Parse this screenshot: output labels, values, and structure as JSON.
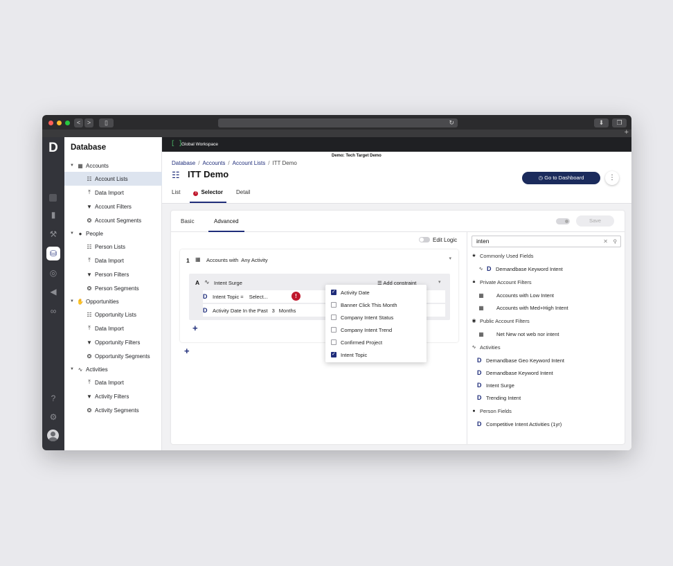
{
  "browser": {
    "back": "<",
    "forward": ">",
    "reload": "↻",
    "new_tab": "+"
  },
  "app": {
    "rail_icons": [
      "home-icon",
      "chart-icon",
      "magic-wand-icon",
      "database-icon",
      "target-icon",
      "megaphone-icon",
      "handshake-icon",
      "help-icon",
      "gear-icon",
      "avatar-icon"
    ],
    "brand_color": "#1f2d7a",
    "error_color": "#c0182d"
  },
  "nav": {
    "title": "Database",
    "tree": [
      {
        "label": "Accounts",
        "icon": "building-icon",
        "children": [
          {
            "label": "Account Lists",
            "icon": "list-icon",
            "selected": true
          },
          {
            "label": "Data Import",
            "icon": "upload-icon"
          },
          {
            "label": "Account Filters",
            "icon": "filter-icon"
          },
          {
            "label": "Account Segments",
            "icon": "segments-icon"
          }
        ]
      },
      {
        "label": "People",
        "icon": "person-icon",
        "children": [
          {
            "label": "Person Lists",
            "icon": "list-icon"
          },
          {
            "label": "Data Import",
            "icon": "upload-icon"
          },
          {
            "label": "Person Filters",
            "icon": "filter-icon"
          },
          {
            "label": "Person Segments",
            "icon": "segments-icon"
          }
        ]
      },
      {
        "label": "Opportunities",
        "icon": "handshake-icon",
        "children": [
          {
            "label": "Opportunity Lists",
            "icon": "list-icon"
          },
          {
            "label": "Data Import",
            "icon": "upload-icon"
          },
          {
            "label": "Opportunity Filters",
            "icon": "filter-icon"
          },
          {
            "label": "Opportunity Segments",
            "icon": "segments-icon"
          }
        ]
      },
      {
        "label": "Activities",
        "icon": "pulse-icon",
        "children": [
          {
            "label": "Data Import",
            "icon": "upload-icon"
          },
          {
            "label": "Activity Filters",
            "icon": "filter-icon"
          },
          {
            "label": "Activity Segments",
            "icon": "segments-icon"
          }
        ]
      }
    ]
  },
  "workspace": {
    "bracket": "[ ]",
    "title": "Global Workspace",
    "demo": "Demo: Tech Target Demo"
  },
  "header": {
    "breadcrumbs": [
      "Database",
      "Accounts",
      "Account Lists",
      "ITT Demo"
    ],
    "title": "ITT Demo",
    "tabs": [
      "List",
      "Selector",
      "Detail"
    ],
    "go_to_dashboard": "Go to Dashboard",
    "more": "⋮"
  },
  "selector": {
    "subtabs": [
      "Basic",
      "Advanced"
    ],
    "save": "Save",
    "edit_logic": "Edit Logic",
    "group": {
      "number": "1",
      "prefix": "Accounts with",
      "scope": "Any Activity",
      "condition": {
        "letter": "A",
        "title": "Intent Surge",
        "add_constraint": "Add constraint",
        "rows": [
          {
            "field": "Intent Topic =",
            "value": "Select..."
          },
          {
            "field": "Activity Date In the Past",
            "value": "3",
            "unit": "Months"
          }
        ]
      }
    },
    "add": "+",
    "constraint_options": [
      {
        "label": "Activity Date",
        "checked": true
      },
      {
        "label": "Banner Click This Month",
        "checked": false
      },
      {
        "label": "Company Intent Status",
        "checked": false
      },
      {
        "label": "Company Intent Trend",
        "checked": false
      },
      {
        "label": "Confirmed Project",
        "checked": false
      },
      {
        "label": "Intent Topic",
        "checked": true
      }
    ]
  },
  "fields": {
    "search_value": "inten",
    "groups": [
      {
        "header": "Commonly Used Fields",
        "icon": "star-icon",
        "items": [
          {
            "label": "Demandbase Keyword Intent",
            "kind": "activity"
          }
        ]
      },
      {
        "header": "Private Account Filters",
        "icon": "lock-icon",
        "items": [
          {
            "label": "Accounts with Low Intent",
            "kind": "list"
          },
          {
            "label": "Accounts with Med+High Intent",
            "kind": "list"
          }
        ]
      },
      {
        "header": "Public Account Filters",
        "icon": "eye-icon",
        "items": [
          {
            "label": "Net New not web nor intent",
            "kind": "list"
          }
        ]
      },
      {
        "header": "Activities",
        "icon": "pulse-icon",
        "items": [
          {
            "label": "Demandbase Geo Keyword Intent",
            "kind": "d"
          },
          {
            "label": "Demandbase Keyword Intent",
            "kind": "d"
          },
          {
            "label": "Intent Surge",
            "kind": "d"
          },
          {
            "label": "Trending Intent",
            "kind": "d"
          }
        ]
      },
      {
        "header": "Person Fields",
        "icon": "person-icon",
        "items": [
          {
            "label": "Competitive Intent Activities (1yr)",
            "kind": "d"
          }
        ]
      }
    ]
  }
}
